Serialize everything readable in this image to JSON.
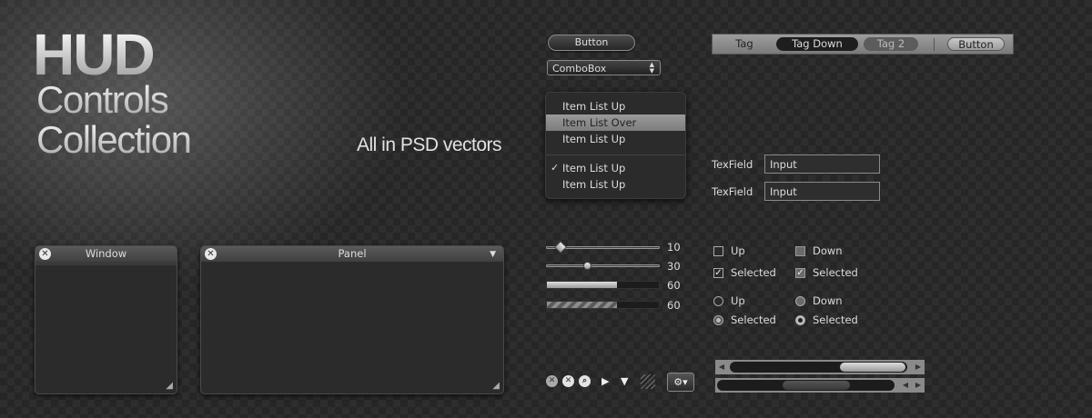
{
  "title": {
    "line1": "HUD",
    "line2": "Controls",
    "line3": "Collection",
    "subtitle": "All in PSD vectors"
  },
  "button": {
    "label": "Button"
  },
  "combobox": {
    "value": "ComboBox"
  },
  "menu": {
    "items": [
      {
        "label": "Item List Up",
        "state": "up"
      },
      {
        "label": "Item List Over",
        "state": "over"
      },
      {
        "label": "Item List Up",
        "state": "up"
      },
      {
        "label": "Item List Up",
        "state": "checked"
      },
      {
        "label": "Item List Up",
        "state": "up"
      }
    ],
    "check_glyph": "✓"
  },
  "tagbar": {
    "tag1": "Tag",
    "tag2": "Tag Down",
    "tag3": "Tag 2",
    "button": "Button"
  },
  "textfields": [
    {
      "label": "TexField",
      "value": "Input"
    },
    {
      "label": "TexField",
      "value": "Input"
    }
  ],
  "windows": {
    "window_title": "Window",
    "panel_title": "Panel"
  },
  "sliders": [
    {
      "value_label": "10",
      "level": 0.13
    },
    {
      "value_label": "30",
      "level": 0.36
    }
  ],
  "progress": [
    {
      "value_label": "60",
      "level": 0.63
    },
    {
      "value_label": "60",
      "level": 0.63
    }
  ],
  "checkboxes": {
    "up": "Up",
    "down": "Down",
    "selected": "Selected",
    "selected_down": "Selected"
  },
  "radios": {
    "up": "Up",
    "down": "Down",
    "selected": "Selected",
    "selected_down": "Selected"
  },
  "icons": [
    "close-circle-icon",
    "close-circle-dark-icon",
    "search-icon",
    "play-icon",
    "triangle-down-icon",
    "resize-grip-icon",
    "gear-icon"
  ],
  "scrollbars": [
    {
      "thumb_position": 0.62,
      "thumb_size": 0.37
    },
    {
      "thumb_position": 0.37,
      "thumb_size": 0.38
    }
  ],
  "colors": {
    "background": "#262626",
    "accent": "#8a8a8a",
    "highlight": "#9a9a9a"
  }
}
